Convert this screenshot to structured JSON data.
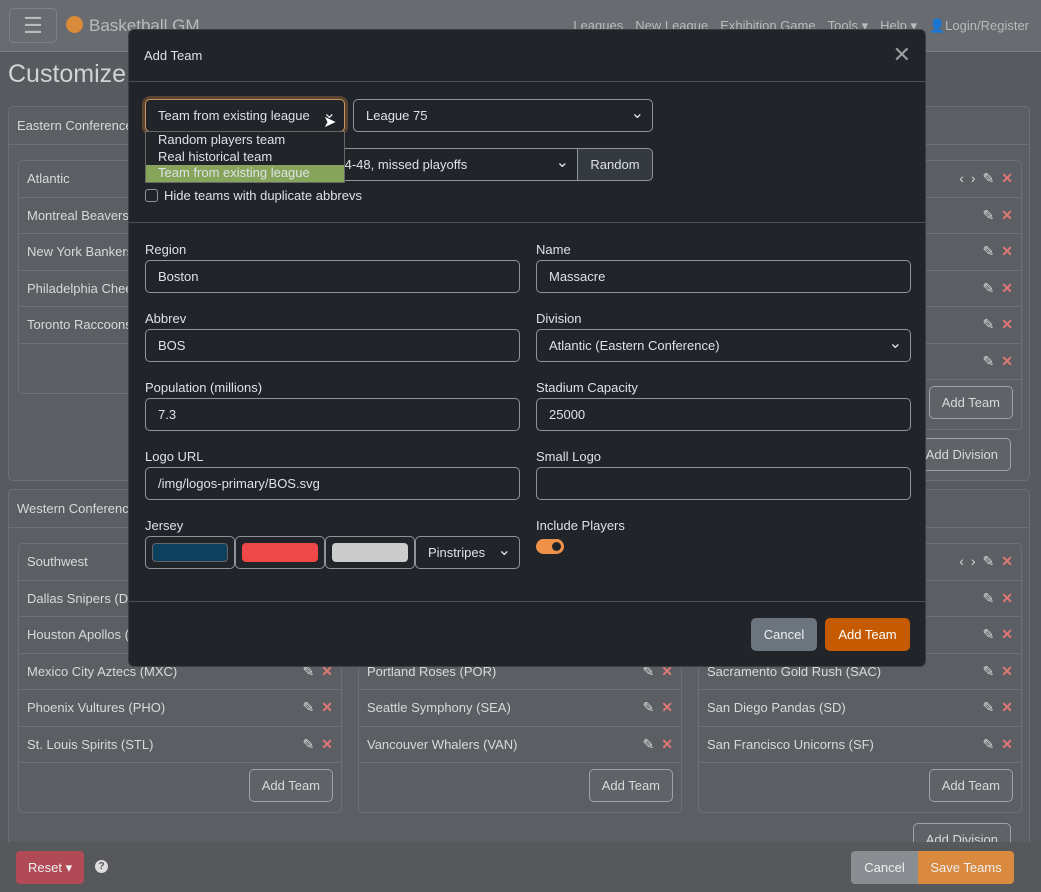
{
  "navbar": {
    "brand": "Basketball GM",
    "links": [
      "Leagues",
      "New League",
      "Exhibition Game",
      "Tools ▾",
      "Help ▾",
      "Login/Register"
    ]
  },
  "page_title": "Customize",
  "eastern": {
    "title": "Eastern Conference",
    "division": "Atlantic",
    "teams": [
      "Montreal Beavers",
      "New York Bankers",
      "Philadelphia Chee",
      "Toronto Raccoons"
    ],
    "add_team": "Add Team",
    "add_division": "Add Division"
  },
  "western": {
    "title": "Western Conference",
    "division": "Southwest",
    "col1": [
      "Dallas Snipers (D",
      "Houston Apollos (",
      "Mexico City Aztecs (MXC)",
      "Phoenix Vultures (PHO)",
      "St. Louis Spirits (STL)"
    ],
    "col2": [
      "Portland Roses (POR)",
      "Seattle Symphony (SEA)",
      "Vancouver Whalers (VAN)"
    ],
    "col3": [
      "Sacramento Gold Rush (SAC)",
      "San Diego Pandas (SD)",
      "San Francisco Unicorns (SF)"
    ],
    "add_team": "Add Team",
    "add_division": "Add Division"
  },
  "footer": {
    "reset": "Reset",
    "cancel": "Cancel",
    "save": "Save Teams"
  },
  "modal": {
    "title": "Add Team",
    "type_value": "Team from existing league",
    "type_options": [
      "Random players team",
      "Real historical team",
      "Team from existing league"
    ],
    "league_value": "League 75",
    "team_value": "BOS) 34-48, missed playoffs",
    "random": "Random",
    "hide_dupes": "Hide teams with duplicate abbrevs",
    "region_label": "Region",
    "region": "Boston",
    "name_label": "Name",
    "name": "Massacre",
    "abbrev_label": "Abbrev",
    "abbrev": "BOS",
    "division_label": "Division",
    "division": "Atlantic (Eastern Conference)",
    "pop_label": "Population (millions)",
    "pop": "7.3",
    "stadium_label": "Stadium Capacity",
    "stadium": "25000",
    "logo_label": "Logo URL",
    "logo": "/img/logos-primary/BOS.svg",
    "small_logo_label": "Small Logo",
    "small_logo": "",
    "jersey_label": "Jersey",
    "jersey_colors": [
      "#0d3f5e",
      "#ef4848",
      "#cccccc"
    ],
    "jersey_style": "Pinstripes",
    "include_label": "Include Players",
    "include_players": true,
    "cancel": "Cancel",
    "add": "Add Team"
  },
  "colors": {
    "accent": "#c55a00",
    "toggle": "#f0914a"
  }
}
